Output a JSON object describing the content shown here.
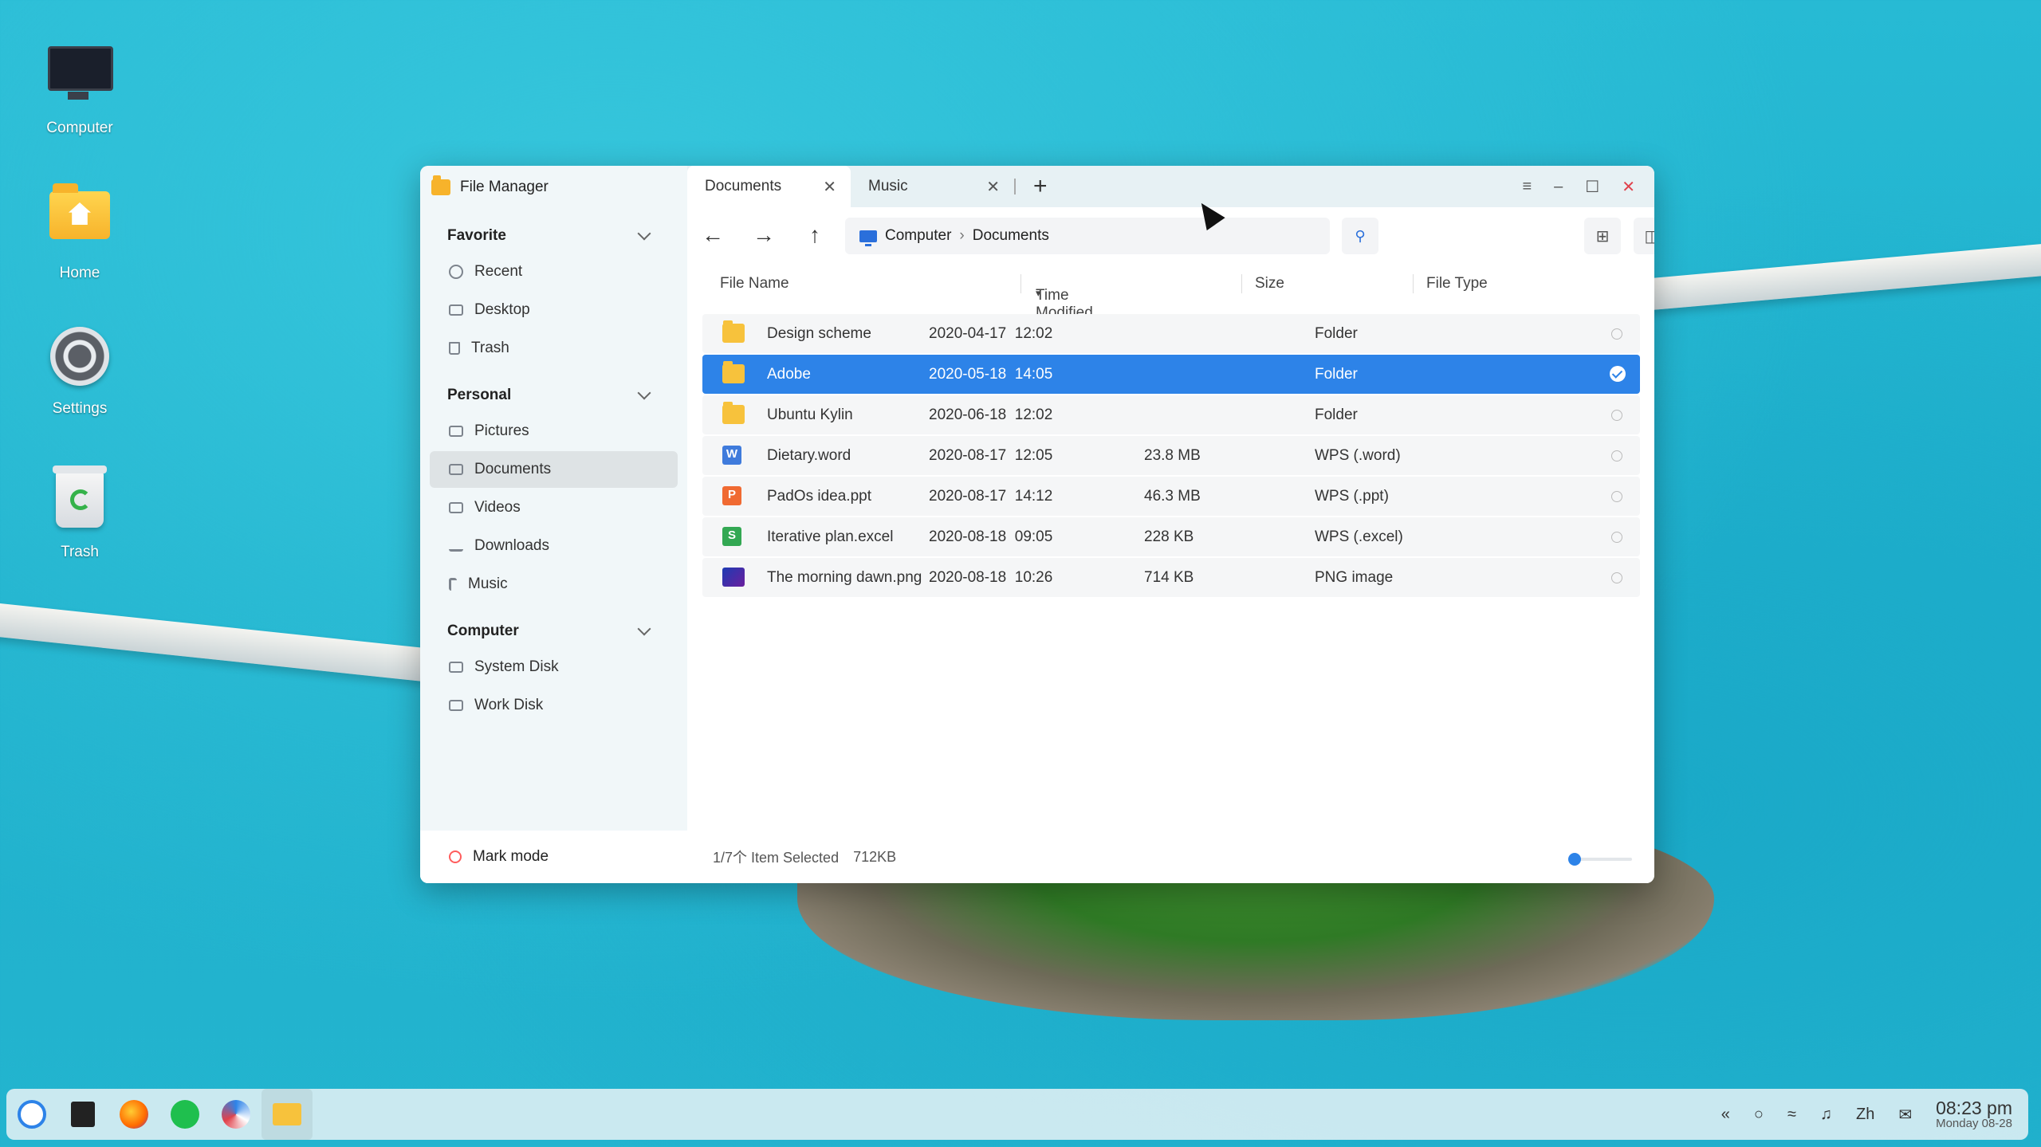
{
  "desktop": {
    "icons": [
      {
        "label": "Computer",
        "icon": "monitor-icon"
      },
      {
        "label": "Home",
        "icon": "home-folder-icon"
      },
      {
        "label": "Settings",
        "icon": "gear-icon"
      },
      {
        "label": "Trash",
        "icon": "trash-bin-icon"
      }
    ]
  },
  "window": {
    "app_title": "File Manager",
    "tabs": [
      {
        "label": "Documents",
        "close": "✕",
        "active": true
      },
      {
        "label": "Music",
        "close": "✕",
        "active": false
      }
    ],
    "new_tab": "+",
    "controls": {
      "menu": "≡",
      "minimize": "–",
      "maximize": "☐",
      "close": "✕"
    }
  },
  "sidebar": {
    "groups": [
      {
        "title": "Favorite",
        "items": [
          {
            "label": "Recent",
            "icon": "clock-icon"
          },
          {
            "label": "Desktop",
            "icon": "desktop-icon"
          },
          {
            "label": "Trash",
            "icon": "trash-icon"
          }
        ]
      },
      {
        "title": "Personal",
        "items": [
          {
            "label": "Pictures",
            "icon": "picture-icon"
          },
          {
            "label": "Documents",
            "icon": "document-icon",
            "active": true
          },
          {
            "label": "Videos",
            "icon": "video-icon"
          },
          {
            "label": "Downloads",
            "icon": "download-icon"
          },
          {
            "label": "Music",
            "icon": "music-icon"
          }
        ]
      },
      {
        "title": "Computer",
        "items": [
          {
            "label": "System Disk",
            "icon": "disk-icon"
          },
          {
            "label": "Work Disk",
            "icon": "disk-icon"
          }
        ]
      }
    ],
    "footer": {
      "label": "Mark mode"
    }
  },
  "toolbar": {
    "back": "←",
    "forward": "→",
    "up": "↑",
    "breadcrumb": [
      "Computer",
      "Documents"
    ],
    "breadcrumb_sep": "›",
    "search_icon": "search-icon",
    "view_icons": [
      "grid-view-icon",
      "detail-view-icon"
    ]
  },
  "columns": {
    "name": "File Name",
    "modified": "Time Modified",
    "size": "Size",
    "type": "File Type"
  },
  "files": [
    {
      "name": "Design scheme",
      "modified": "2020-04-17  12:02",
      "size": "",
      "type": "Folder",
      "icon": "folder",
      "selected": false
    },
    {
      "name": "Adobe",
      "modified": "2020-05-18  14:05",
      "size": "",
      "type": "Folder",
      "icon": "folder",
      "selected": true
    },
    {
      "name": "Ubuntu Kylin",
      "modified": "2020-06-18  12:02",
      "size": "",
      "type": "Folder",
      "icon": "folder",
      "selected": false
    },
    {
      "name": "Dietary.word",
      "modified": "2020-08-17  12:05",
      "size": "23.8 MB",
      "type": "WPS (.word)",
      "icon": "word",
      "selected": false
    },
    {
      "name": "PadOs idea.ppt",
      "modified": "2020-08-17  14:12",
      "size": "46.3 MB",
      "type": "WPS (.ppt)",
      "icon": "ppt",
      "selected": false
    },
    {
      "name": "Iterative plan.excel",
      "modified": "2020-08-18  09:05",
      "size": "228 KB",
      "type": "WPS (.excel)",
      "icon": "excel",
      "selected": false
    },
    {
      "name": "The morning dawn.png",
      "modified": "2020-08-18  10:26",
      "size": "714 KB",
      "type": "PNG image",
      "icon": "png",
      "selected": false
    }
  ],
  "status": {
    "selection": "1/7个 Item Selected",
    "size": "712KB",
    "zoom_level": 0.0
  },
  "taskbar": {
    "apps": [
      "kylin-start-icon",
      "multitask-icon",
      "firefox-icon",
      "chat-icon",
      "software-center-icon",
      "file-manager-icon"
    ],
    "tray": {
      "expand": "«",
      "search": "○",
      "wifi": "wifi-icon",
      "volume": "volume-icon",
      "ime": "Zh",
      "notify": "notification-icon"
    },
    "time": "08:23 pm",
    "date": "Monday 08-28"
  }
}
